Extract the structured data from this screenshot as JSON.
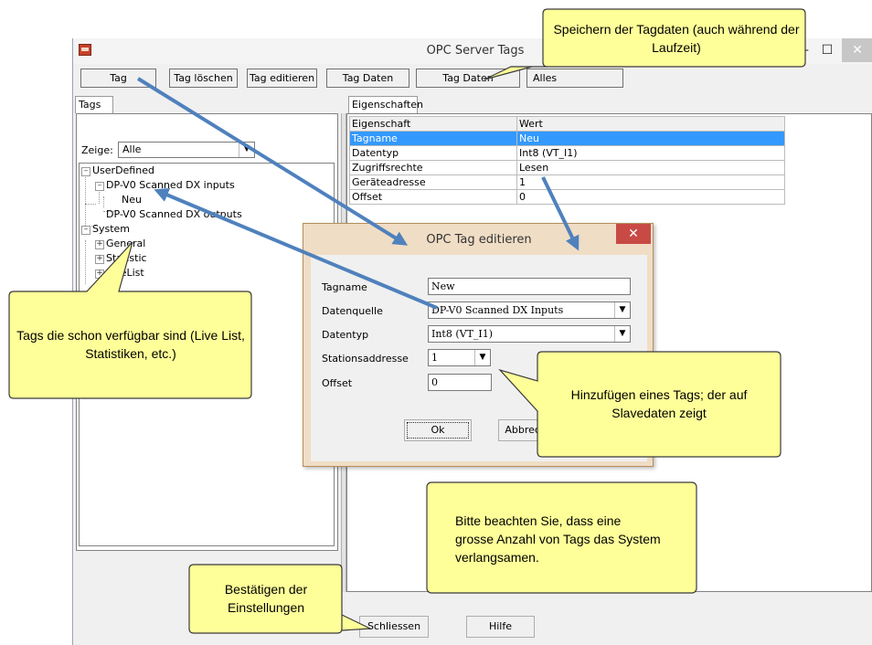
{
  "window": {
    "title": "OPC Server Tags",
    "minimize": "—",
    "maximize": "☐",
    "close": "✕"
  },
  "toolbar": {
    "add_tag": "Tag hinzufügen",
    "delete_tag": "Tag löschen",
    "edit_tag": "Tag editieren",
    "load_data": "Tag Daten laden",
    "save_data": "Tag Daten speichern",
    "all": "Alles"
  },
  "left_pane": {
    "tab": "Tags",
    "show_label": "Zeige:",
    "show_value": "Alle",
    "tree": {
      "user_defined": "UserDefined",
      "dp_inputs": "DP-V0 Scanned DX inputs",
      "neu": "Neu",
      "dp_outputs": "DP-V0 Scanned DX outputs",
      "system": "System",
      "general": "General",
      "statistic": "Statistic",
      "livelist": "LiveList"
    }
  },
  "right_pane": {
    "tab": "Eigenschaften",
    "columns": [
      "Eigenschaft",
      "Wert"
    ],
    "rows": [
      [
        "Tagname",
        "Neu"
      ],
      [
        "Datentyp",
        "Int8 (VT_I1)"
      ],
      [
        "Zugriffsrechte",
        "Lesen"
      ],
      [
        "Geräteadresse",
        "1"
      ],
      [
        "Offset",
        "0"
      ]
    ]
  },
  "bottom": {
    "close": "Schliessen",
    "help": "Hilfe"
  },
  "dialog": {
    "title": "OPC Tag editieren",
    "close": "✕",
    "tagname_label": "Tagname",
    "tagname_value": "New",
    "source_label": "Datenquelle",
    "source_value": "DP-V0 Scanned DX Inputs",
    "type_label": "Datentyp",
    "type_value": "Int8 (VT_I1)",
    "station_label": "Stationsaddresse",
    "station_value": "1",
    "offset_label": "Offset",
    "offset_value": "0",
    "ok": "Ok",
    "cancel": "Abbrechen"
  },
  "callouts": {
    "save": "Speichern der Tagdaten (auch während der Laufzeit)",
    "available": "Tags die schon verfügbar sind (Live List, Statistiken, etc.)",
    "add": "Hinzufügen eines Tags; der auf Slavedaten zeigt",
    "note": "Bitte beachten Sie, dass eine grosse Anzahl von Tags das System verlangsamen.",
    "confirm": "Bestätigen der Einstellungen"
  },
  "colors": {
    "callout_fill": "#ffff99",
    "callout_border": "#3b3b3b",
    "arrow": "#4f81bd",
    "selection": "#3399ff",
    "dialog_frame": "#f0ddc5",
    "dialog_close": "#c84a45"
  }
}
